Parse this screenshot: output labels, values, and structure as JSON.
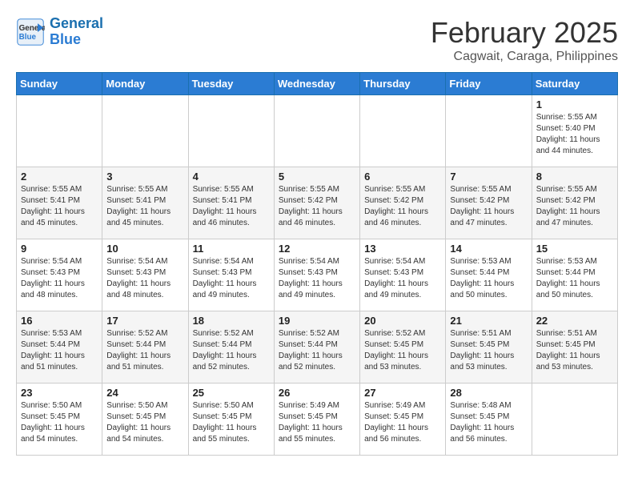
{
  "header": {
    "logo_line1": "General",
    "logo_line2": "Blue",
    "month": "February 2025",
    "location": "Cagwait, Caraga, Philippines"
  },
  "days_of_week": [
    "Sunday",
    "Monday",
    "Tuesday",
    "Wednesday",
    "Thursday",
    "Friday",
    "Saturday"
  ],
  "weeks": [
    [
      {
        "day": "",
        "info": ""
      },
      {
        "day": "",
        "info": ""
      },
      {
        "day": "",
        "info": ""
      },
      {
        "day": "",
        "info": ""
      },
      {
        "day": "",
        "info": ""
      },
      {
        "day": "",
        "info": ""
      },
      {
        "day": "1",
        "info": "Sunrise: 5:55 AM\nSunset: 5:40 PM\nDaylight: 11 hours\nand 44 minutes."
      }
    ],
    [
      {
        "day": "2",
        "info": "Sunrise: 5:55 AM\nSunset: 5:41 PM\nDaylight: 11 hours\nand 45 minutes."
      },
      {
        "day": "3",
        "info": "Sunrise: 5:55 AM\nSunset: 5:41 PM\nDaylight: 11 hours\nand 45 minutes."
      },
      {
        "day": "4",
        "info": "Sunrise: 5:55 AM\nSunset: 5:41 PM\nDaylight: 11 hours\nand 46 minutes."
      },
      {
        "day": "5",
        "info": "Sunrise: 5:55 AM\nSunset: 5:42 PM\nDaylight: 11 hours\nand 46 minutes."
      },
      {
        "day": "6",
        "info": "Sunrise: 5:55 AM\nSunset: 5:42 PM\nDaylight: 11 hours\nand 46 minutes."
      },
      {
        "day": "7",
        "info": "Sunrise: 5:55 AM\nSunset: 5:42 PM\nDaylight: 11 hours\nand 47 minutes."
      },
      {
        "day": "8",
        "info": "Sunrise: 5:55 AM\nSunset: 5:42 PM\nDaylight: 11 hours\nand 47 minutes."
      }
    ],
    [
      {
        "day": "9",
        "info": "Sunrise: 5:54 AM\nSunset: 5:43 PM\nDaylight: 11 hours\nand 48 minutes."
      },
      {
        "day": "10",
        "info": "Sunrise: 5:54 AM\nSunset: 5:43 PM\nDaylight: 11 hours\nand 48 minutes."
      },
      {
        "day": "11",
        "info": "Sunrise: 5:54 AM\nSunset: 5:43 PM\nDaylight: 11 hours\nand 49 minutes."
      },
      {
        "day": "12",
        "info": "Sunrise: 5:54 AM\nSunset: 5:43 PM\nDaylight: 11 hours\nand 49 minutes."
      },
      {
        "day": "13",
        "info": "Sunrise: 5:54 AM\nSunset: 5:43 PM\nDaylight: 11 hours\nand 49 minutes."
      },
      {
        "day": "14",
        "info": "Sunrise: 5:53 AM\nSunset: 5:44 PM\nDaylight: 11 hours\nand 50 minutes."
      },
      {
        "day": "15",
        "info": "Sunrise: 5:53 AM\nSunset: 5:44 PM\nDaylight: 11 hours\nand 50 minutes."
      }
    ],
    [
      {
        "day": "16",
        "info": "Sunrise: 5:53 AM\nSunset: 5:44 PM\nDaylight: 11 hours\nand 51 minutes."
      },
      {
        "day": "17",
        "info": "Sunrise: 5:52 AM\nSunset: 5:44 PM\nDaylight: 11 hours\nand 51 minutes."
      },
      {
        "day": "18",
        "info": "Sunrise: 5:52 AM\nSunset: 5:44 PM\nDaylight: 11 hours\nand 52 minutes."
      },
      {
        "day": "19",
        "info": "Sunrise: 5:52 AM\nSunset: 5:44 PM\nDaylight: 11 hours\nand 52 minutes."
      },
      {
        "day": "20",
        "info": "Sunrise: 5:52 AM\nSunset: 5:45 PM\nDaylight: 11 hours\nand 53 minutes."
      },
      {
        "day": "21",
        "info": "Sunrise: 5:51 AM\nSunset: 5:45 PM\nDaylight: 11 hours\nand 53 minutes."
      },
      {
        "day": "22",
        "info": "Sunrise: 5:51 AM\nSunset: 5:45 PM\nDaylight: 11 hours\nand 53 minutes."
      }
    ],
    [
      {
        "day": "23",
        "info": "Sunrise: 5:50 AM\nSunset: 5:45 PM\nDaylight: 11 hours\nand 54 minutes."
      },
      {
        "day": "24",
        "info": "Sunrise: 5:50 AM\nSunset: 5:45 PM\nDaylight: 11 hours\nand 54 minutes."
      },
      {
        "day": "25",
        "info": "Sunrise: 5:50 AM\nSunset: 5:45 PM\nDaylight: 11 hours\nand 55 minutes."
      },
      {
        "day": "26",
        "info": "Sunrise: 5:49 AM\nSunset: 5:45 PM\nDaylight: 11 hours\nand 55 minutes."
      },
      {
        "day": "27",
        "info": "Sunrise: 5:49 AM\nSunset: 5:45 PM\nDaylight: 11 hours\nand 56 minutes."
      },
      {
        "day": "28",
        "info": "Sunrise: 5:48 AM\nSunset: 5:45 PM\nDaylight: 11 hours\nand 56 minutes."
      },
      {
        "day": "",
        "info": ""
      }
    ]
  ]
}
